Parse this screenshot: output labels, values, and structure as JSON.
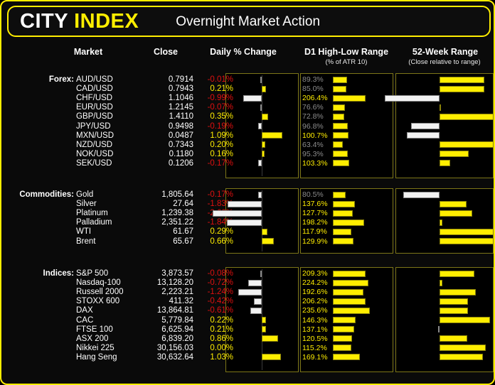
{
  "header": {
    "brand_first": "CITY",
    "brand_second": "INDEX",
    "title": "Overnight Market Action"
  },
  "columns": {
    "market": "Market",
    "close": "Close",
    "daily_change": "Daily % Change",
    "d1_range": "D1 High-Low Range",
    "d1_range_sub": "(% of ATR 10)",
    "week52_range": "52-Week Range",
    "week52_range_sub": "(Close relative to range)"
  },
  "colors": {
    "accent": "#ffee00",
    "positive": "#ffee00",
    "negative": "#e01010",
    "bar_positive": "#ffee00",
    "bar_negative": "#f2f2f2",
    "panel_border": "#7d7618",
    "background": "#000000"
  },
  "groups": [
    {
      "label": "Forex:",
      "rows": [
        {
          "market": "AUD/USD",
          "close": "0.7914",
          "change": "-0.01%",
          "change_value": -0.01,
          "d1": "89.3%",
          "d1_value": 89.3,
          "w52": 52,
          "w52_above": true
        },
        {
          "market": "CAD/USD",
          "close": "0.7943",
          "change": "0.21%",
          "change_value": 0.21,
          "d1": "85.0%",
          "d1_value": 85.0,
          "w52": 52,
          "w52_above": true
        },
        {
          "market": "CHF/USD",
          "close": "1.1046",
          "change": "-0.99%",
          "change_value": -0.99,
          "d1": "206.4%",
          "d1_value": 206.4,
          "w52": 63,
          "w52_above": false
        },
        {
          "market": "EUR/USD",
          "close": "1.2145",
          "change": "-0.07%",
          "change_value": -0.07,
          "d1": "76.6%",
          "d1_value": 76.6,
          "w52": 1,
          "w52_above": true
        },
        {
          "market": "GBP/USD",
          "close": "1.4110",
          "change": "0.35%",
          "change_value": 0.35,
          "d1": "72.8%",
          "d1_value": 72.8,
          "w52": 62,
          "w52_above": true
        },
        {
          "market": "JPY/USD",
          "close": "0.9498",
          "change": "-0.19%",
          "change_value": -0.19,
          "d1": "96.8%",
          "d1_value": 96.8,
          "w52": 33,
          "w52_above": false
        },
        {
          "market": "MXN/USD",
          "close": "0.0487",
          "change": "1.09%",
          "change_value": 1.09,
          "d1": "100.7%",
          "d1_value": 100.7,
          "w52": 38,
          "w52_above": false
        },
        {
          "market": "NZD/USD",
          "close": "0.7343",
          "change": "0.20%",
          "change_value": 0.2,
          "d1": "63.4%",
          "d1_value": 63.4,
          "w52": 62,
          "w52_above": true
        },
        {
          "market": "NOK/USD",
          "close": "0.1180",
          "change": "0.16%",
          "change_value": 0.16,
          "d1": "95.3%",
          "d1_value": 95.3,
          "w52": 34,
          "w52_above": true
        },
        {
          "market": "SEK/USD",
          "close": "0.1206",
          "change": "-0.17%",
          "change_value": -0.17,
          "d1": "103.3%",
          "d1_value": 103.3,
          "w52": 12,
          "w52_above": true
        }
      ]
    },
    {
      "label": "Commodities:",
      "rows": [
        {
          "market": "Gold",
          "close": "1,805.64",
          "change": "-0.17%",
          "change_value": -0.17,
          "d1": "80.5%",
          "d1_value": 80.5,
          "w52": 42,
          "w52_above": false
        },
        {
          "market": "Silver",
          "close": "27.64",
          "change": "-1.83%",
          "change_value": -1.83,
          "d1": "137.6%",
          "d1_value": 137.6,
          "w52": 31,
          "w52_above": true
        },
        {
          "market": "Platinum",
          "close": "1,239.38",
          "change": "-2.60%",
          "change_value": -2.6,
          "d1": "127.7%",
          "d1_value": 127.7,
          "w52": 38,
          "w52_above": true
        },
        {
          "market": "Palladium",
          "close": "2,351.22",
          "change": "-1.84%",
          "change_value": -1.84,
          "d1": "198.2%",
          "d1_value": 198.2,
          "w52": 3,
          "w52_above": true
        },
        {
          "market": "WTI",
          "close": "61.67",
          "change": "0.29%",
          "change_value": 0.29,
          "d1": "117.9%",
          "d1_value": 117.9,
          "w52": 62,
          "w52_above": true
        },
        {
          "market": "Brent",
          "close": "65.67",
          "change": "0.66%",
          "change_value": 0.66,
          "d1": "129.9%",
          "d1_value": 129.9,
          "w52": 62,
          "w52_above": true
        }
      ]
    },
    {
      "label": "Indices:",
      "rows": [
        {
          "market": "S&P 500",
          "close": "3,873.57",
          "change": "-0.08%",
          "change_value": -0.08,
          "d1": "209.3%",
          "d1_value": 209.3,
          "w52": 40,
          "w52_above": true
        },
        {
          "market": "Nasdaq-100",
          "close": "13,128.20",
          "change": "-0.72%",
          "change_value": -0.72,
          "d1": "224.2%",
          "d1_value": 224.2,
          "w52": 3,
          "w52_above": true
        },
        {
          "market": "Russell 2000",
          "close": "2,223.21",
          "change": "-1.24%",
          "change_value": -1.24,
          "d1": "192.6%",
          "d1_value": 192.6,
          "w52": 42,
          "w52_above": true
        },
        {
          "market": "STOXX 600",
          "close": "411.32",
          "change": "-0.42%",
          "change_value": -0.42,
          "d1": "206.2%",
          "d1_value": 206.2,
          "w52": 33,
          "w52_above": true
        },
        {
          "market": "DAX",
          "close": "13,864.81",
          "change": "-0.61%",
          "change_value": -0.61,
          "d1": "235.6%",
          "d1_value": 235.6,
          "w52": 33,
          "w52_above": true
        },
        {
          "market": "CAC",
          "close": "5,779.84",
          "change": "0.22%",
          "change_value": 0.22,
          "d1": "146.3%",
          "d1_value": 146.3,
          "w52": 58,
          "w52_above": true
        },
        {
          "market": "FTSE 100",
          "close": "6,625.94",
          "change": "0.21%",
          "change_value": 0.21,
          "d1": "137.1%",
          "d1_value": 137.1,
          "w52": 2,
          "w52_above": false
        },
        {
          "market": "ASX 200",
          "close": "6,839.20",
          "change": "0.86%",
          "change_value": 0.86,
          "d1": "120.5%",
          "d1_value": 120.5,
          "w52": 32,
          "w52_above": true
        },
        {
          "market": "Nikkei 225",
          "close": "30,156.03",
          "change": "0.00%",
          "change_value": 0.0,
          "d1": "115.2%",
          "d1_value": 115.2,
          "w52": 53,
          "w52_above": true
        },
        {
          "market": "Hang Seng",
          "close": "30,632.64",
          "change": "1.03%",
          "change_value": 1.03,
          "d1": "169.1%",
          "d1_value": 169.1,
          "w52": 50,
          "w52_above": true
        }
      ]
    }
  ],
  "chart_data": {
    "type": "bar",
    "title": "Overnight Market Action",
    "panels": [
      {
        "name": "Daily % Change",
        "unit": "%",
        "baseline": "zero",
        "direction": "bidirectional"
      },
      {
        "name": "D1 High-Low Range",
        "unit": "% of ATR 10",
        "baseline": "left",
        "direction": "right"
      },
      {
        "name": "52-Week Range",
        "unit": "percentile of 52w range",
        "baseline": "center",
        "direction": "bidirectional"
      }
    ],
    "categories": [
      "AUD/USD",
      "CAD/USD",
      "CHF/USD",
      "EUR/USD",
      "GBP/USD",
      "JPY/USD",
      "MXN/USD",
      "NZD/USD",
      "NOK/USD",
      "SEK/USD",
      "Gold",
      "Silver",
      "Platinum",
      "Palladium",
      "WTI",
      "Brent",
      "S&P 500",
      "Nasdaq-100",
      "Russell 2000",
      "STOXX 600",
      "DAX",
      "CAC",
      "FTSE 100",
      "ASX 200",
      "Nikkei 225",
      "Hang Seng"
    ],
    "series": [
      {
        "name": "Daily % Change",
        "values": [
          -0.01,
          0.21,
          -0.99,
          -0.07,
          0.35,
          -0.19,
          1.09,
          0.2,
          0.16,
          -0.17,
          -0.17,
          -1.83,
          -2.6,
          -1.84,
          0.29,
          0.66,
          -0.08,
          -0.72,
          -1.24,
          -0.42,
          -0.61,
          0.22,
          0.21,
          0.86,
          0.0,
          1.03
        ]
      },
      {
        "name": "D1 High-Low Range (% of ATR 10)",
        "values": [
          89.3,
          85.0,
          206.4,
          76.6,
          72.8,
          96.8,
          100.7,
          63.4,
          95.3,
          103.3,
          80.5,
          137.6,
          127.7,
          198.2,
          117.9,
          129.9,
          209.3,
          224.2,
          192.6,
          206.2,
          235.6,
          146.3,
          137.1,
          120.5,
          115.2,
          169.1
        ]
      }
    ],
    "close_values": [
      0.7914,
      0.7943,
      1.1046,
      1.2145,
      1.411,
      0.9498,
      0.0487,
      0.7343,
      0.118,
      0.1206,
      1805.64,
      27.64,
      1239.38,
      2351.22,
      61.67,
      65.67,
      3873.57,
      13128.2,
      2223.21,
      411.32,
      13864.81,
      5779.84,
      6625.94,
      6839.2,
      30156.03,
      30632.64
    ]
  }
}
